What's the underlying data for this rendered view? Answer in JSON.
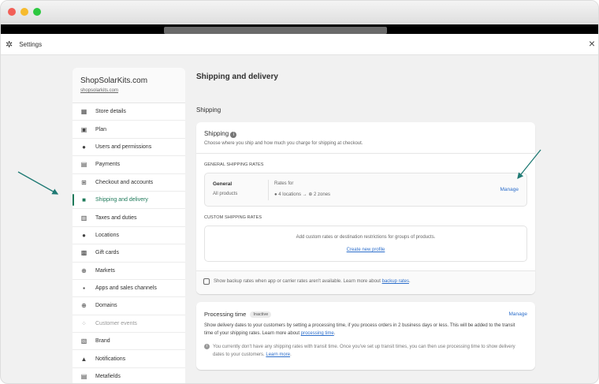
{
  "window": {
    "title": "Settings",
    "close": "×"
  },
  "sidebar": {
    "store_name": "ShopSolarKits.com",
    "store_url": "shopsolarkits.com",
    "items": [
      {
        "label": "Store details",
        "icon": "store-icon",
        "glyph": "▦"
      },
      {
        "label": "Plan",
        "icon": "plan-icon",
        "glyph": "▣"
      },
      {
        "label": "Users and permissions",
        "icon": "user-icon",
        "glyph": "●"
      },
      {
        "label": "Payments",
        "icon": "payments-icon",
        "glyph": "▤"
      },
      {
        "label": "Checkout and accounts",
        "icon": "cart-icon",
        "glyph": "⊞"
      },
      {
        "label": "Shipping and delivery",
        "icon": "truck-icon",
        "glyph": "■",
        "active": true
      },
      {
        "label": "Taxes and duties",
        "icon": "taxes-icon",
        "glyph": "▥"
      },
      {
        "label": "Locations",
        "icon": "location-icon",
        "glyph": "●"
      },
      {
        "label": "Gift cards",
        "icon": "gift-icon",
        "glyph": "▩"
      },
      {
        "label": "Markets",
        "icon": "globe-icon",
        "glyph": "⊕"
      },
      {
        "label": "Apps and sales channels",
        "icon": "apps-icon",
        "glyph": "▪"
      },
      {
        "label": "Domains",
        "icon": "domains-icon",
        "glyph": "⊕"
      },
      {
        "label": "Customer events",
        "icon": "customer-events-icon",
        "glyph": "⁘",
        "dim": true
      },
      {
        "label": "Brand",
        "icon": "brand-icon",
        "glyph": "▧"
      },
      {
        "label": "Notifications",
        "icon": "bell-icon",
        "glyph": "▲"
      },
      {
        "label": "Metafields",
        "icon": "metafields-icon",
        "glyph": "▤"
      }
    ]
  },
  "main": {
    "title": "Shipping and delivery",
    "section": "Shipping",
    "shipping": {
      "title": "Shipping",
      "desc": "Choose where you ship and how much you charge for shipping at checkout.",
      "general_label": "GENERAL SHIPPING RATES",
      "general": {
        "name": "General",
        "sub": "All products",
        "rates_for": "Rates for",
        "locations": "4 locations",
        "zones": "2 zones",
        "manage": "Manage"
      },
      "custom_label": "CUSTOM SHIPPING RATES",
      "custom_text": "Add custom rates or destination restrictions for groups of products.",
      "create": "Create new profile",
      "backup_text": "Show backup rates when app or carrier rates aren't available. Learn more about ",
      "backup_link": "backup rates",
      "backup_checked": false
    },
    "processing": {
      "title": "Processing time",
      "badge": "Inactive",
      "manage": "Manage",
      "desc": "Show delivery dates to your customers by setting a processing time, if you process orders in 2 business days or less. This will be added to the transit time of your shipping rates. Learn more about ",
      "desc_link": "processing time",
      "note": "You currently don't have any shipping rates with transit time. Once you've set up transit times, you can then use processing time to show delivery dates to your customers. ",
      "note_link": "Learn more"
    }
  },
  "colors": {
    "accent": "#1f7a5a",
    "link": "#2c6ecb",
    "arrow": "#1f7a74"
  }
}
